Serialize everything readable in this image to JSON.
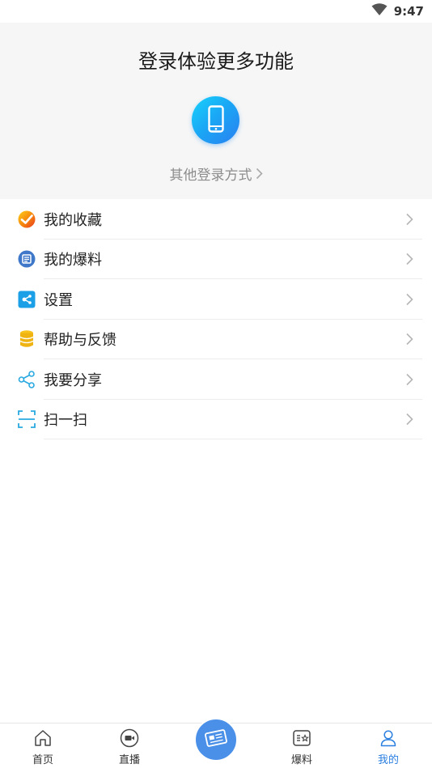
{
  "status_bar": {
    "time": "9:47",
    "wifi_icon": "wifi-icon"
  },
  "login": {
    "title": "登录体验更多功能",
    "phone_icon": "phone-icon",
    "other_login": "其他登录方式"
  },
  "menu": {
    "items": [
      {
        "label": "我的收藏",
        "icon": "favorites-icon"
      },
      {
        "label": "我的爆料",
        "icon": "reports-icon"
      },
      {
        "label": "设置",
        "icon": "settings-icon"
      },
      {
        "label": "帮助与反馈",
        "icon": "help-feedback-icon"
      },
      {
        "label": "我要分享",
        "icon": "share-icon"
      },
      {
        "label": "扫一扫",
        "icon": "scan-icon"
      }
    ]
  },
  "tabbar": {
    "items": [
      {
        "label": "首页",
        "icon": "home-icon"
      },
      {
        "label": "直播",
        "icon": "video-icon"
      },
      {
        "label": "爆料",
        "icon": "report-star-icon"
      },
      {
        "label": "我的",
        "icon": "user-icon",
        "active": true
      }
    ],
    "center_icon": "newspaper-icon",
    "active_color": "#2b7fe0"
  }
}
